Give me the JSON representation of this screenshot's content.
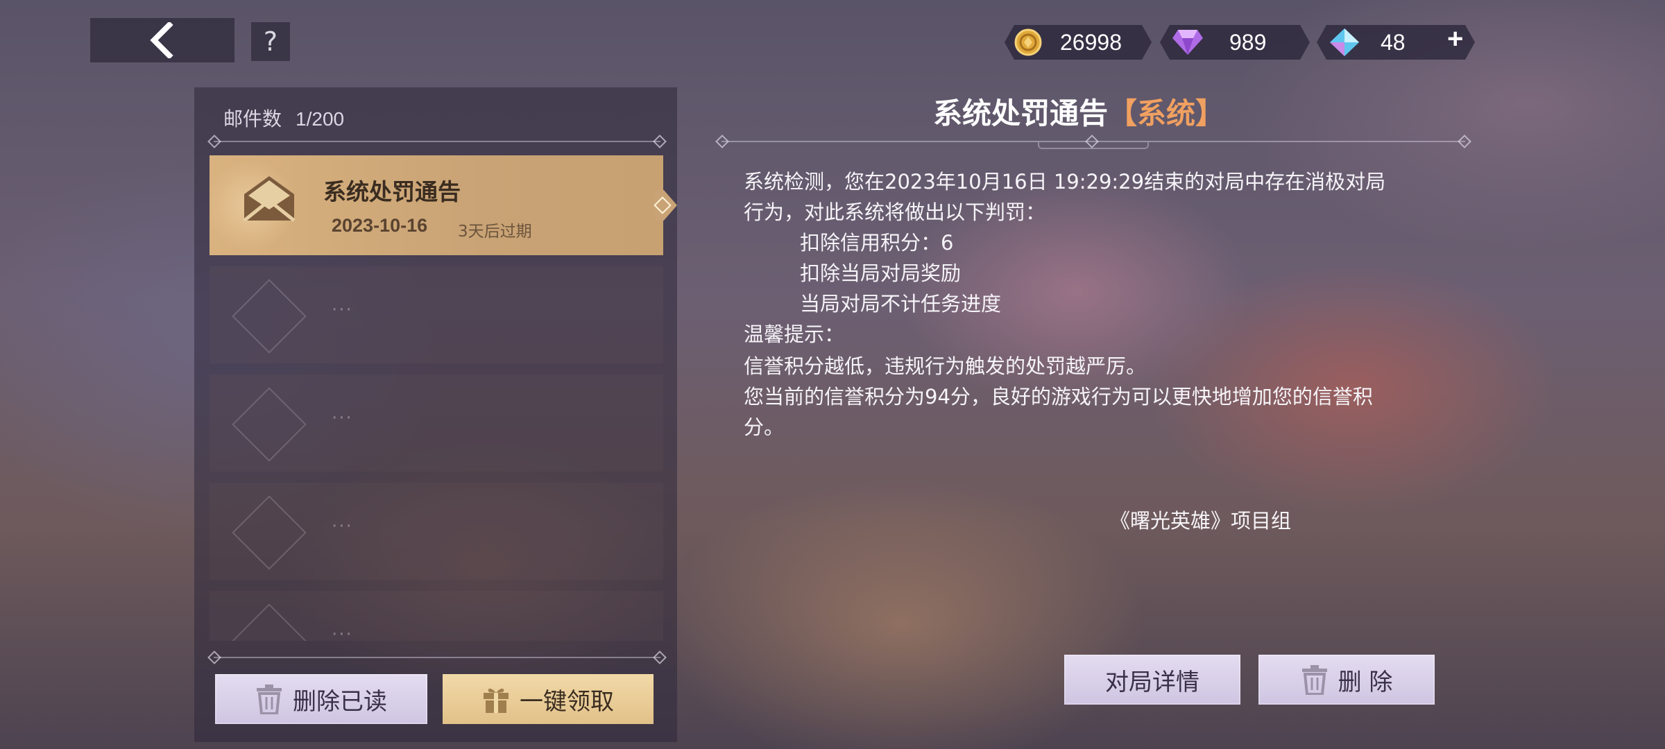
{
  "topbar": {
    "help_label": "?",
    "currencies": [
      {
        "name": "gold-coin",
        "value": "26998",
        "color": "#e0a93a"
      },
      {
        "name": "purple-gem",
        "value": "989",
        "color": "#b06be6"
      },
      {
        "name": "blue-crystal",
        "value": "48",
        "color": "#5fc7ef"
      }
    ],
    "add_label": "+"
  },
  "mailbox": {
    "count_label": "邮件数",
    "count_value": "1/200",
    "selected": {
      "title": "系统处罚通告",
      "date": "2023-10-16",
      "expire": "3天后过期"
    },
    "placeholder_dots": "···",
    "buttons": {
      "delete_read": "删除已读",
      "claim_all": "一键领取"
    }
  },
  "detail": {
    "title": "系统处罚通告",
    "tag": "【系统】",
    "lines": [
      "系统检测，您在2023年10月16日 19:29:29结束的对局中存在消极对局",
      "行为，对此系统将做出以下判罚：",
      "扣除信用积分：6",
      "扣除当局对局奖励",
      "当局对局不计任务进度",
      "温馨提示：",
      "信誉积分越低，违规行为触发的处罚越严厉。",
      "您当前的信誉积分为94分，良好的游戏行为可以更快地增加您的信誉积",
      "分。"
    ],
    "signature": "《曙光英雄》项目组",
    "buttons": {
      "match_detail": "对局详情",
      "delete": "删 除"
    }
  }
}
